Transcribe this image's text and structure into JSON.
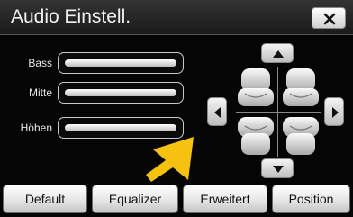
{
  "window": {
    "title": "Audio Einstell."
  },
  "colors": {
    "accent_arrow": "#f5c20f",
    "background": "#050505",
    "button_face": "#e6e6e6"
  },
  "icons": {
    "close": "close-icon",
    "up": "arrow-up-icon",
    "down": "arrow-down-icon",
    "left": "arrow-left-icon",
    "right": "arrow-right-icon",
    "seat": "car-seat-icon",
    "pointer": "pointer-arrow-icon"
  },
  "sliders": [
    {
      "label": "Bass"
    },
    {
      "label": "Mitte"
    },
    {
      "label": "Höhen"
    }
  ],
  "bottom_buttons": [
    {
      "label": "Default"
    },
    {
      "label": "Equalizer"
    },
    {
      "label": "Erweitert"
    },
    {
      "label": "Position"
    }
  ]
}
